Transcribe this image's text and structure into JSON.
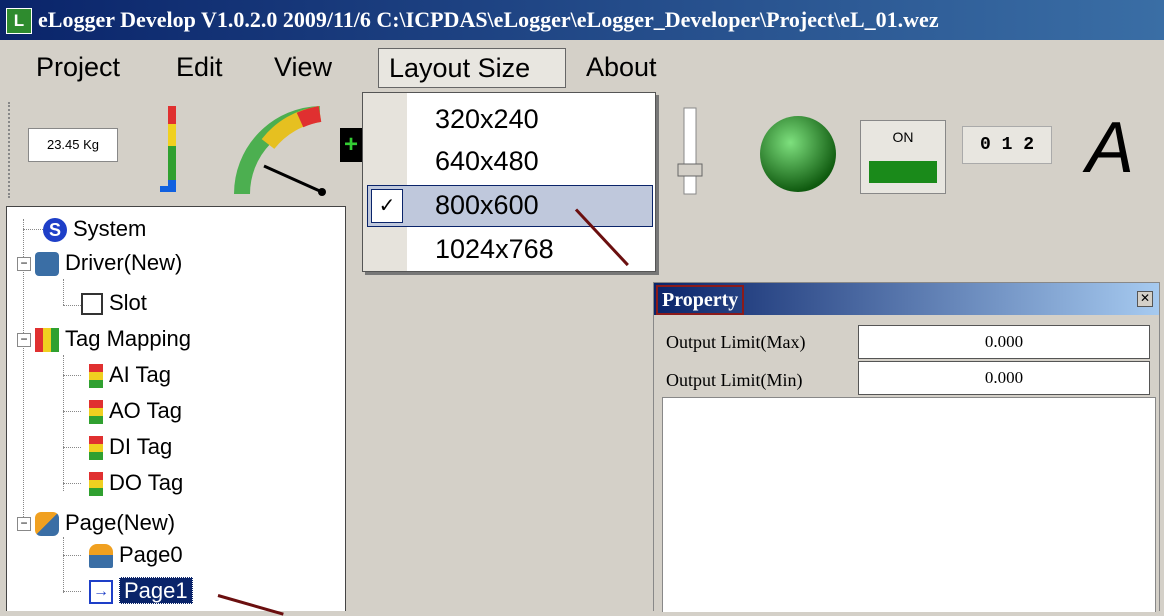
{
  "window": {
    "title": "eLogger Develop V1.0.2.0  2009/11/6  C:\\ICPDAS\\eLogger\\eLogger_Developer\\Project\\eL_01.wez",
    "logo_letter": "L"
  },
  "menubar": {
    "items": [
      "Project",
      "Edit",
      "View",
      "Layout Size",
      "About"
    ]
  },
  "toolbar": {
    "weight_value": "23.45 Kg",
    "switch_label": "ON",
    "digits_label": "0 1 2",
    "text_tool_label": "A",
    "plus_label": "+"
  },
  "layout_menu": {
    "options": [
      "320x240",
      "640x480",
      "800x600",
      "1024x768"
    ],
    "selected": "800x600",
    "check_mark": "✓"
  },
  "tree": {
    "nodes": [
      {
        "label": "System"
      },
      {
        "label": "Driver(New)"
      },
      {
        "label": "Slot"
      },
      {
        "label": "Tag Mapping"
      },
      {
        "label": "AI Tag"
      },
      {
        "label": "AO Tag"
      },
      {
        "label": "DI Tag"
      },
      {
        "label": "DO Tag"
      },
      {
        "label": "Page(New)"
      },
      {
        "label": "Page0"
      },
      {
        "label": "Page1"
      }
    ],
    "expander_symbol": "−"
  },
  "property_panel": {
    "title": "Property",
    "close_symbol": "✕",
    "rows": [
      {
        "label": "Output Limit(Max)",
        "value": "0.000"
      },
      {
        "label": "Output Limit(Min)",
        "value": "0.000"
      }
    ]
  },
  "colors": {
    "title_bar": "#0a246a",
    "selection": "#0a246a",
    "annotation_arrow": "#6b0f0f",
    "lamp_green": "#1e8a1e"
  }
}
